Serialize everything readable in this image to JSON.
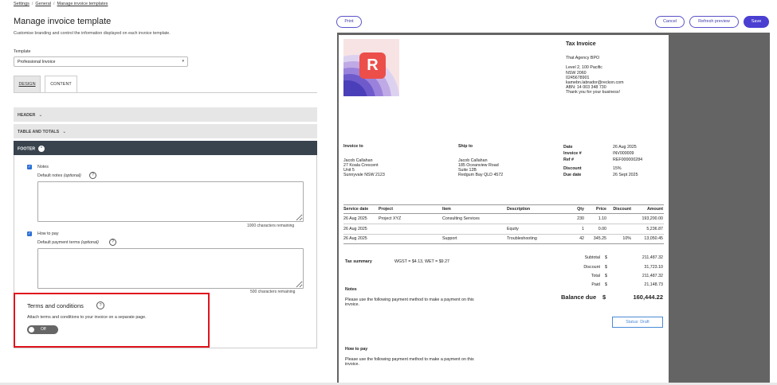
{
  "breadcrumb": {
    "items": [
      "Settings",
      "General",
      "Manage invoice templates"
    ],
    "separator": "/"
  },
  "page": {
    "title": "Manage invoice template",
    "subtitle": "Customise branding and control the information displayed on each invoice template."
  },
  "template": {
    "label": "Template",
    "selected": "Professional Invoice"
  },
  "tabs": {
    "design": "DESIGN",
    "content": "CONTENT"
  },
  "sections": {
    "header": "HEADER",
    "table": "TABLE AND TOTALS",
    "footer": "FOOTER"
  },
  "footer": {
    "notes": {
      "label": "Notes",
      "checked": true,
      "field_label": "Default notes",
      "optional": "(optional)",
      "remaining": "1000 characters remaining",
      "value": ""
    },
    "how_to_pay": {
      "label": "How to pay",
      "checked": true,
      "field_label": "Default payment terms",
      "optional": "(optional)",
      "remaining": "500 characters remaining",
      "value": ""
    },
    "terms": {
      "title": "Terms and conditions",
      "desc": "Attach terms and conditions to your invoice on a separate page.",
      "toggle": "Off"
    }
  },
  "actions": {
    "print": "Print",
    "cancel": "Cancel",
    "refresh": "Refresh preview",
    "save": "Save"
  },
  "invoice": {
    "title": "Tax Invoice",
    "company": [
      "That Agency BPO",
      "",
      "Level 2, 100 Pacific",
      " NSW 2060",
      "0245678901",
      "kamebn.labrador@reckon.com",
      "ABN: 14 003 348 730",
      "Thank you for your business!"
    ],
    "invoice_to_label": "Invoice to",
    "invoice_to": [
      "Jacob Callahan",
      "27 Koala Crescent",
      "Unit 5",
      "Sunnyvale NSW 2123"
    ],
    "ship_to_label": "Ship to",
    "ship_to": [
      "Jacob Callahan",
      "185 Oceanview Road",
      "Suite 12B",
      "Redgum Bay QLD 4572"
    ],
    "meta": {
      "date_label": "Date",
      "date": "26 Aug 2025",
      "invoice_no_label": "Invoice #",
      "invoice_no": "INV000009",
      "ref_label": "Ref #",
      "ref": "REF000000284",
      "discount_label": "Discount",
      "discount": "15%",
      "due_label": "Due date",
      "due": "26 Sept 2025"
    },
    "columns": [
      "Service date",
      "Project",
      "Item",
      "Description",
      "Qty",
      "Price",
      "Discount",
      "Amount"
    ],
    "rows": [
      [
        "26 Aug 2025",
        "Project XYZ",
        "Consulting Services",
        "",
        "230",
        "1.10",
        "",
        "193,200.00"
      ],
      [
        "26 Aug 2025",
        "",
        "",
        "Equity",
        "1",
        "0.00",
        "",
        "5,236.87"
      ],
      [
        "26 Aug 2025",
        "",
        "Support",
        "Troubleshooting",
        "42",
        "345.25",
        "10%",
        "13,050.45"
      ]
    ],
    "tax_summary_label": "Tax summary",
    "tax_summary": "WGST = $4.13, WET = $9.27",
    "totals": {
      "subtotal_label": "Subtotal",
      "subtotal": "211,487.32",
      "discount_label": "Discount",
      "discount": "31,723.10",
      "total_label": "Total",
      "total": "211,487.32",
      "paid_label": "Paid",
      "paid": "21,148.73",
      "currency": "$"
    },
    "balance_label": "Balance due",
    "balance": "160,444.22",
    "notes_label": "Notes",
    "notes_text": [
      "Please use the following payment method to make a payment on this",
      "invoice."
    ],
    "status": "Status: Draft",
    "how_to_pay_label": "How to pay",
    "how_to_pay_text": [
      "Please use the following payment method to make a payment on this",
      "invoice."
    ]
  }
}
